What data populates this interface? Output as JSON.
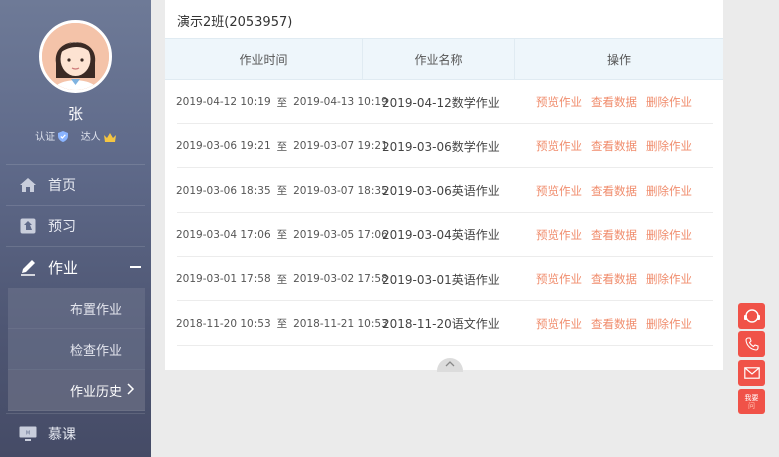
{
  "sidebar": {
    "user_name": "张",
    "badges": {
      "verified": "认证",
      "expert": "达人"
    },
    "nav": [
      {
        "label": "首页",
        "icon": "home-icon"
      },
      {
        "label": "预习",
        "icon": "preview-icon"
      },
      {
        "label": "作业",
        "icon": "pencil-icon"
      },
      {
        "label": "慕课",
        "icon": "mooc-icon"
      }
    ],
    "homework_sub": [
      {
        "label": "布置作业"
      },
      {
        "label": "检查作业"
      },
      {
        "label": "作业历史"
      }
    ]
  },
  "card": {
    "title": "演示2班(2053957)",
    "columns": [
      "作业时间",
      "作业名称",
      "操作"
    ],
    "to_word": "至",
    "rows": [
      {
        "start": "2019-04-12 10:19",
        "end": "2019-04-13 10:19",
        "name": "2019-04-12数学作业"
      },
      {
        "start": "2019-03-06 19:21",
        "end": "2019-03-07 19:21",
        "name": "2019-03-06数学作业"
      },
      {
        "start": "2019-03-06 18:35",
        "end": "2019-03-07 18:35",
        "name": "2019-03-06英语作业"
      },
      {
        "start": "2019-03-04 17:06",
        "end": "2019-03-05 17:06",
        "name": "2019-03-04英语作业"
      },
      {
        "start": "2019-03-01 17:58",
        "end": "2019-03-02 17:58",
        "name": "2019-03-01英语作业"
      },
      {
        "start": "2018-11-20 10:53",
        "end": "2018-11-21 10:53",
        "name": "2018-11-20语文作业"
      }
    ],
    "actions": {
      "preview": "预览作业",
      "view": "查看数据",
      "delete": "删除作业"
    }
  },
  "float": {
    "chat_label": "我要",
    "chat_label2": "问"
  },
  "colors": {
    "accent": "#f08c6c",
    "float_red": "#f05248",
    "sidebar": "#5f6a8a"
  }
}
